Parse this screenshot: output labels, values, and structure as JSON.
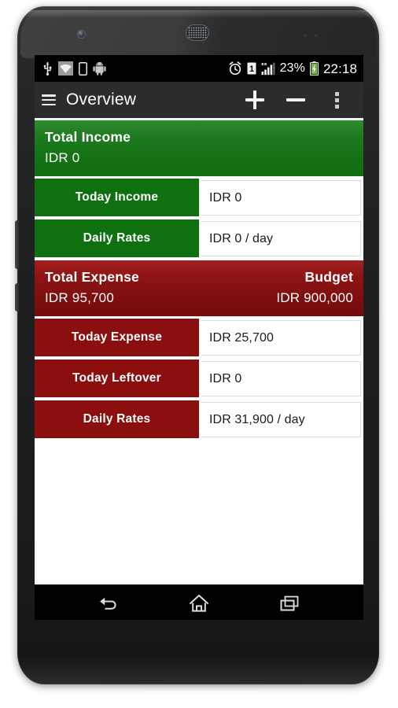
{
  "device": {
    "name": "android-phone",
    "front_camera": "front-camera",
    "earpiece": "earpiece-speaker"
  },
  "status_bar": {
    "left_icons": [
      "usb-icon",
      "wifi-icon",
      "vibrate-icon",
      "android-icon"
    ],
    "alarm_icon": "alarm-clock-icon",
    "sim_label": "1",
    "signal_icon": "signal-bars-icon",
    "battery_percent": "23%",
    "battery_icon": "battery-charging-icon",
    "clock": "22:18"
  },
  "action_bar": {
    "menu_icon": "hamburger-menu-icon",
    "title": "Overview",
    "add_icon": "plus-icon",
    "subtract_icon": "minus-icon",
    "overflow_icon": "overflow-menu-icon"
  },
  "income": {
    "title": "Total Income",
    "value": "IDR 0",
    "color": "#147214",
    "rows": [
      {
        "label": "Today Income",
        "value": "IDR 0"
      },
      {
        "label": "Daily Rates",
        "value": "IDR 0 / day"
      }
    ]
  },
  "expense": {
    "title": "Total Expense",
    "value": "IDR 95,700",
    "budget_title": "Budget",
    "budget_value": "IDR 900,000",
    "color": "#7c0e0e",
    "rows": [
      {
        "label": "Today Expense",
        "value": "IDR 25,700"
      },
      {
        "label": "Today Leftover",
        "value": "IDR 0"
      },
      {
        "label": "Daily Rates",
        "value": "IDR 31,900 / day"
      }
    ]
  },
  "nav_bar": {
    "back": "back-icon",
    "home": "home-icon",
    "recents": "recents-icon"
  }
}
